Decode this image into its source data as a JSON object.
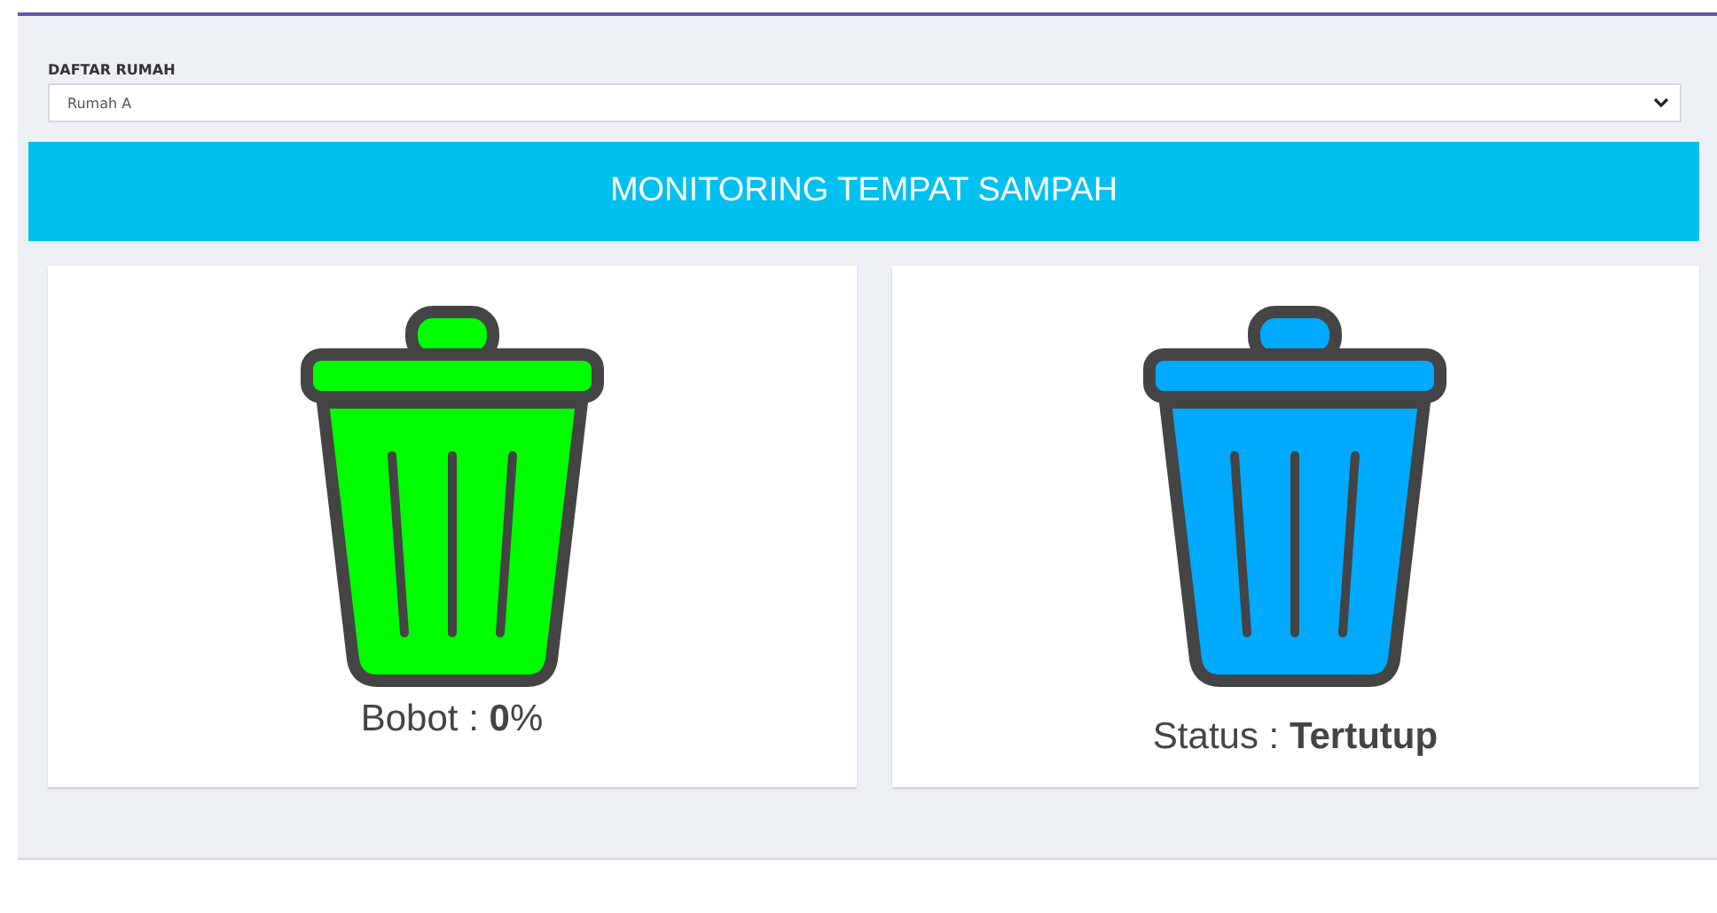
{
  "house_select": {
    "label": "DAFTAR RUMAH",
    "value": "Rumah A"
  },
  "banner": {
    "title": "MONITORING TEMPAT SAMPAH"
  },
  "cards": [
    {
      "kind": "weight",
      "color": "#00ff00",
      "caption": "Bobot : **0**%"
    },
    {
      "kind": "status",
      "color": "#00aaff",
      "caption": "Status : **Tertutup**"
    }
  ]
}
